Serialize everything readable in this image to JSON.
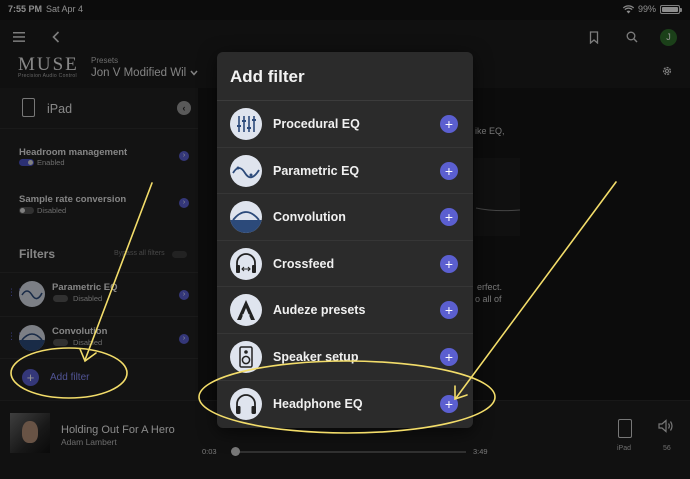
{
  "statusbar": {
    "time": "7:55 PM",
    "date": "Sat Apr 4",
    "battery": "99%",
    "battery_level": 0.99
  },
  "topbar": {
    "brand": "MUSE",
    "brand_tagline": "Precision Audio Control",
    "presets_label": "Presets",
    "preset_value": "Jon V Modified Wil",
    "user_initial": "J"
  },
  "sidebar": {
    "device": "iPad",
    "settings": [
      {
        "title": "Headroom management",
        "state": "Enabled",
        "enabled": true
      },
      {
        "title": "Sample rate conversion",
        "state": "Disabled",
        "enabled": false
      }
    ],
    "filters_heading": "Filters",
    "bypass_label": "Bypass all filters",
    "filters": [
      {
        "name": "Parametric EQ",
        "state": "Disabled"
      },
      {
        "name": "Convolution",
        "state": "Disabled"
      }
    ],
    "add_filter": "Add filter"
  },
  "background_text": {
    "line1": "ike EQ,",
    "line2": "erfect.",
    "line3": "o all of"
  },
  "modal": {
    "title": "Add filter",
    "options": [
      {
        "label": "Procedural EQ",
        "icon": "procedural-eq-icon"
      },
      {
        "label": "Parametric EQ",
        "icon": "parametric-eq-icon"
      },
      {
        "label": "Convolution",
        "icon": "convolution-icon"
      },
      {
        "label": "Crossfeed",
        "icon": "crossfeed-icon"
      },
      {
        "label": "Audeze presets",
        "icon": "audeze-icon"
      },
      {
        "label": "Speaker setup",
        "icon": "speaker-icon"
      },
      {
        "label": "Headphone EQ",
        "icon": "headphone-icon"
      }
    ]
  },
  "player": {
    "title": "Holding Out For A Hero",
    "artist": "Adam Lambert",
    "elapsed": "0:03",
    "duration": "3:49",
    "progress": 0.013,
    "output_device": "iPad",
    "volume": "56"
  },
  "colors": {
    "accent": "#5b5fd0",
    "annotation": "#f3dd6a",
    "background": "#161616",
    "modal": "#2b2b2b"
  }
}
